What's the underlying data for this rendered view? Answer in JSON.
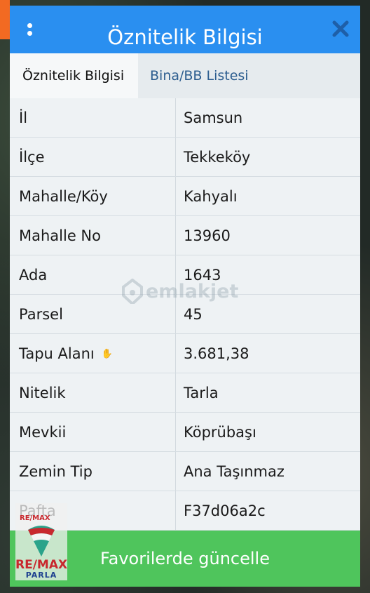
{
  "dialog": {
    "title": "Öznitelik Bilgisi",
    "tabs": [
      {
        "label": "Öznitelik Bilgisi",
        "active": true
      },
      {
        "label": "Bina/BB Listesi",
        "active": false
      }
    ],
    "rows": [
      {
        "label": "İl",
        "value": "Samsun"
      },
      {
        "label": "İlçe",
        "value": "Tekkeköy"
      },
      {
        "label": "Mahalle/Köy",
        "value": "Kahyalı"
      },
      {
        "label": "Mahalle No",
        "value": "13960"
      },
      {
        "label": "Ada",
        "value": "1643"
      },
      {
        "label": "Parsel",
        "value": "45"
      },
      {
        "label": "Tapu Alanı",
        "value": "3.681,38"
      },
      {
        "label": "Nitelik",
        "value": "Tarla"
      },
      {
        "label": "Mevkii",
        "value": "Köprübaşı"
      },
      {
        "label": "Zemin Tip",
        "value": "Ana Taşınmaz"
      },
      {
        "label": "Pafta",
        "value": "F37d06a2c"
      }
    ],
    "footer_button": "Favorilerde güncelle"
  },
  "watermark": {
    "text": "emlakjet"
  },
  "logo": {
    "top": "RE/MAX",
    "main": "RE/MAX",
    "sub": "PARLA"
  },
  "colors": {
    "titlebar": "#2a8ff0",
    "footer": "#4fc55c",
    "accent_orange": "#f26a22"
  },
  "icons": {
    "menu": "kebab-menu-icon",
    "close": "close-icon"
  }
}
